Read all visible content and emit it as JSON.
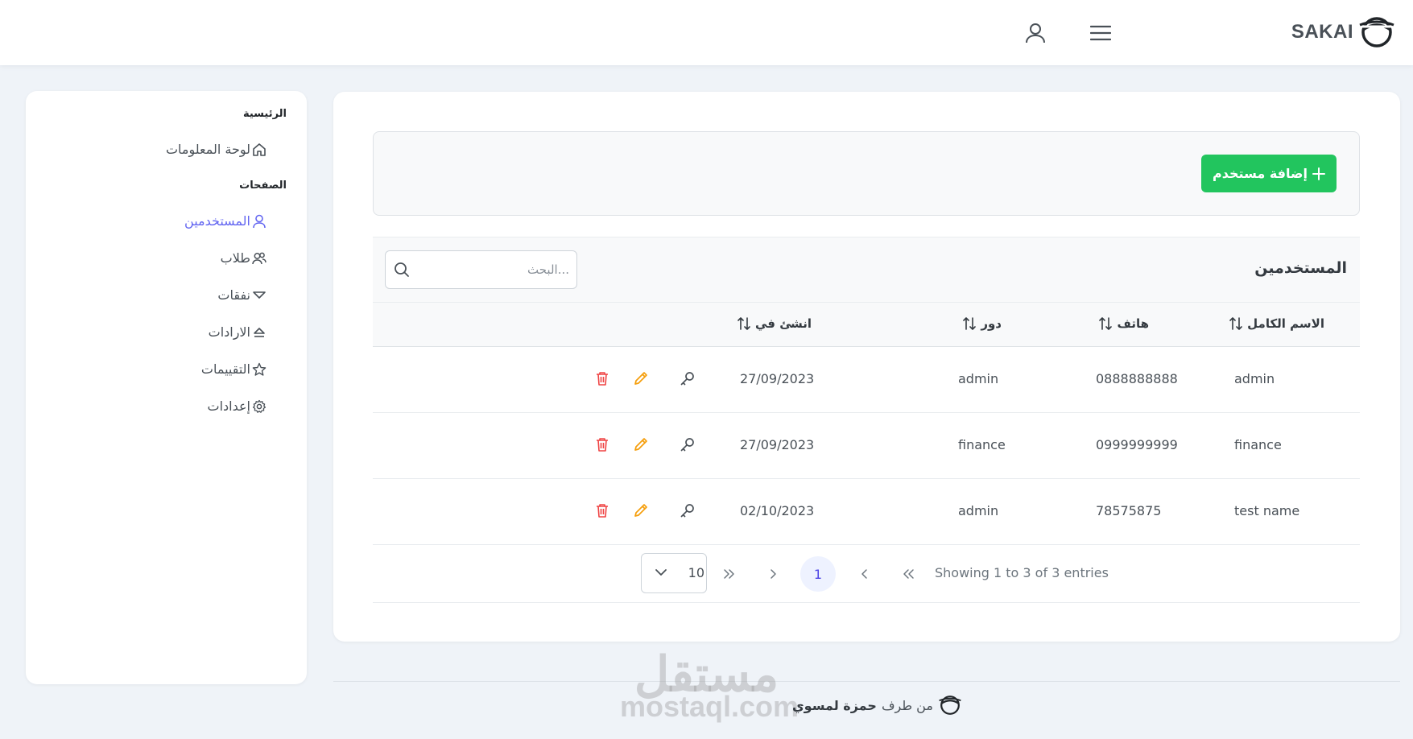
{
  "app": {
    "name": "SAKAI"
  },
  "topbar": {
    "menu_icon": "hamburger-icon",
    "user_icon": "user-icon"
  },
  "sidebar": {
    "home_section": "الرئيسية",
    "dashboard": "لوحة المعلومات",
    "pages_section": "الصفحات",
    "items": [
      {
        "label": "المستخدمين",
        "icon": "user-icon",
        "active": true
      },
      {
        "label": "طلاب",
        "icon": "users-icon"
      },
      {
        "label": "نفقات",
        "icon": "chevron-down-icon"
      },
      {
        "label": "الارادات",
        "icon": "eject-icon"
      },
      {
        "label": "التقييمات",
        "icon": "star-icon"
      },
      {
        "label": "إعدادات",
        "icon": "cog-icon"
      }
    ]
  },
  "toolbar": {
    "add_label": "إضافة مستخدم"
  },
  "table": {
    "title": "المستخدمين",
    "search_placeholder": "...البحث",
    "columns": {
      "fullname": "الاسم الكامل",
      "phone": "هاتف",
      "role": "دور",
      "created": "انشئ في"
    },
    "rows": [
      {
        "fullname": "admin",
        "phone": "0888888888",
        "role": "admin",
        "created": "27/09/2023"
      },
      {
        "fullname": "finance",
        "phone": "0999999999",
        "role": "finance",
        "created": "27/09/2023"
      },
      {
        "fullname": "test name",
        "phone": "78575875",
        "role": "admin",
        "created": "02/10/2023"
      }
    ]
  },
  "paginator": {
    "report": "Showing 1 to 3 of 3 entries",
    "current_page": "1",
    "rows_per_page": "10"
  },
  "footer": {
    "by": "من طرف",
    "author": "حمزة لمسوي"
  },
  "watermark": {
    "arabic": "مستقل",
    "latin": "mostaql.com"
  },
  "colors": {
    "accent": "#6366f1",
    "success": "#22c55e",
    "danger": "#ef4444",
    "warning": "#f59e0b",
    "background": "#eff3f8"
  }
}
